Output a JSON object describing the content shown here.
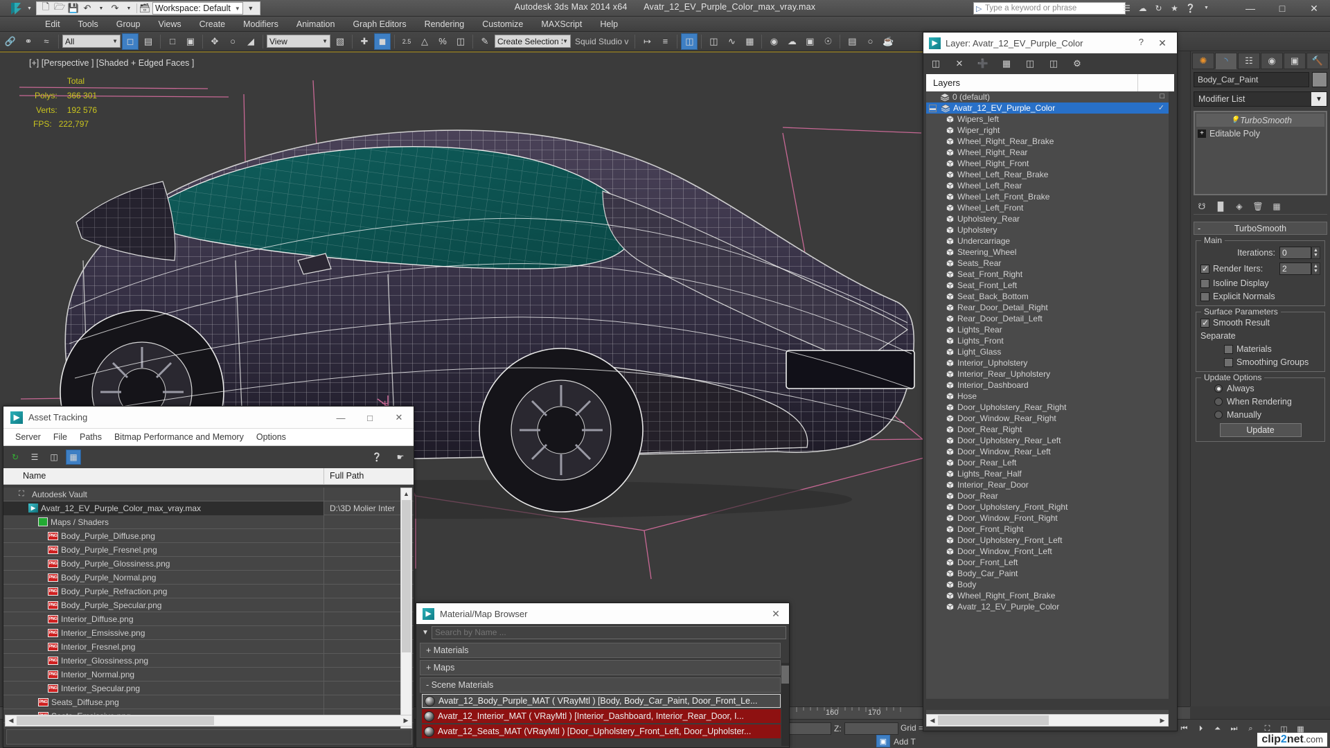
{
  "titlebar": {
    "app_title": "Autodesk 3ds Max  2014 x64",
    "file_title": "Avatr_12_EV_Purple_Color_max_vray.max",
    "workspace": "Workspace: Default",
    "search_placeholder": "Type a keyword or phrase",
    "quick_access": [
      "new-icon",
      "open-icon",
      "save-icon",
      "undo-icon",
      "redo-icon",
      "set-project-icon"
    ],
    "window_buttons": {
      "minimize": "—",
      "maximize": "□",
      "close": "✕"
    }
  },
  "menubar": {
    "items": [
      "Edit",
      "Tools",
      "Group",
      "Views",
      "Create",
      "Modifiers",
      "Animation",
      "Graph Editors",
      "Rendering",
      "Customize",
      "MAXScript",
      "Help"
    ]
  },
  "toolbar": {
    "selection_filter": "All",
    "ref_coord_system": "View",
    "named_selection_set": "Create Selection Se",
    "squid_label": "Squid Studio v",
    "percent_label": "%",
    "snap_label": "2.5"
  },
  "viewport": {
    "label": "[+] [Perspective ] [Shaded + Edged Faces ]",
    "stats_header": "Total",
    "polys_label": "Polys:",
    "polys_value": "366 301",
    "verts_label": "Verts:",
    "verts_value": "192 576",
    "fps_label": "FPS:",
    "fps_value": "222,797"
  },
  "asset_tracking": {
    "title": "Asset Tracking",
    "menu": [
      "Server",
      "File",
      "Paths",
      "Bitmap Performance and Memory",
      "Options"
    ],
    "columns": [
      "Name",
      "Full Path"
    ],
    "window_buttons": {
      "minimize": "—",
      "maximize": "□",
      "close": "✕"
    },
    "rows": [
      {
        "name": "Autodesk Vault",
        "path": "",
        "indent": 1,
        "icon": "vault-icon"
      },
      {
        "name": "Avatr_12_EV_Purple_Color_max_vray.max",
        "path": "D:\\3D Molier Inter",
        "indent": 2,
        "icon": "max-file-icon",
        "selected": true
      },
      {
        "name": "Maps / Shaders",
        "path": "",
        "indent": 3,
        "icon": "shader-icon"
      },
      {
        "name": "Body_Purple_Diffuse.png",
        "path": "",
        "indent": 4,
        "icon": "png-icon"
      },
      {
        "name": "Body_Purple_Fresnel.png",
        "path": "",
        "indent": 4,
        "icon": "png-icon"
      },
      {
        "name": "Body_Purple_Glossiness.png",
        "path": "",
        "indent": 4,
        "icon": "png-icon"
      },
      {
        "name": "Body_Purple_Normal.png",
        "path": "",
        "indent": 4,
        "icon": "png-icon"
      },
      {
        "name": "Body_Purple_Refraction.png",
        "path": "",
        "indent": 4,
        "icon": "png-icon"
      },
      {
        "name": "Body_Purple_Specular.png",
        "path": "",
        "indent": 4,
        "icon": "png-icon"
      },
      {
        "name": "Interior_Diffuse.png",
        "path": "",
        "indent": 4,
        "icon": "png-icon"
      },
      {
        "name": "Interior_Emsissive.png",
        "path": "",
        "indent": 4,
        "icon": "png-icon"
      },
      {
        "name": "Interior_Fresnel.png",
        "path": "",
        "indent": 4,
        "icon": "png-icon"
      },
      {
        "name": "Interior_Glossiness.png",
        "path": "",
        "indent": 4,
        "icon": "png-icon"
      },
      {
        "name": "Interior_Normal.png",
        "path": "",
        "indent": 4,
        "icon": "png-icon"
      },
      {
        "name": "Interior_Specular.png",
        "path": "",
        "indent": 4,
        "icon": "png-icon"
      },
      {
        "name": "Seats_Diffuse.png",
        "path": "",
        "indent": 3,
        "icon": "png-icon"
      },
      {
        "name": "Seats_Emsissive.png",
        "path": "",
        "indent": 3,
        "icon": "png-icon"
      }
    ]
  },
  "material_browser": {
    "title": "Material/Map Browser",
    "search_placeholder": "Search by Name ...",
    "groups": [
      {
        "label": "+ Materials",
        "expanded": false
      },
      {
        "label": "+ Maps",
        "expanded": false
      },
      {
        "label": "- Scene Materials",
        "expanded": true
      }
    ],
    "scene_materials": [
      {
        "label": "Avatr_12_Body_Purple_MAT ( VRayMtl ) [Body, Body_Car_Paint, Door_Front_Le...",
        "selected": true
      },
      {
        "label": "Avatr_12_Interior_MAT ( VRayMtl ) [Interior_Dashboard, Interior_Rear_Door, I...",
        "selected": false
      },
      {
        "label": "Avatr_12_Seats_MAT (VRayMtl ) [Door_Upholstery_Front_Left, Door_Upholster...",
        "selected": false
      }
    ]
  },
  "layer_explorer": {
    "title": "Layer: Avatr_12_EV_Purple_Color",
    "help_glyph": "?",
    "close_glyph": "✕",
    "toolbar_icons": [
      "new-layer-icon",
      "delete-layer-icon",
      "add-layer-icon",
      "select-objects-icon",
      "select-highlighted-icon",
      "highlight-selected-icon",
      "layer-properties-icon"
    ],
    "column_header": "Layers",
    "rows": [
      {
        "name": "0 (default)",
        "type": "layer",
        "selected": false,
        "right": "□"
      },
      {
        "name": "Avatr_12_EV_Purple_Color",
        "type": "layer",
        "selected": true,
        "expandable": true,
        "right": "✓"
      },
      {
        "name": "Wipers_left",
        "type": "object"
      },
      {
        "name": "Wiper_right",
        "type": "object"
      },
      {
        "name": "Wheel_Right_Rear_Brake",
        "type": "object"
      },
      {
        "name": "Wheel_Right_Rear",
        "type": "object"
      },
      {
        "name": "Wheel_Right_Front",
        "type": "object"
      },
      {
        "name": "Wheel_Left_Rear_Brake",
        "type": "object"
      },
      {
        "name": "Wheel_Left_Rear",
        "type": "object"
      },
      {
        "name": "Wheel_Left_Front_Brake",
        "type": "object"
      },
      {
        "name": "Wheel_Left_Front",
        "type": "object"
      },
      {
        "name": "Upholstery_Rear",
        "type": "object"
      },
      {
        "name": "Upholstery",
        "type": "object"
      },
      {
        "name": "Undercarriage",
        "type": "object"
      },
      {
        "name": "Steering_Wheel",
        "type": "object"
      },
      {
        "name": "Seats_Rear",
        "type": "object"
      },
      {
        "name": "Seat_Front_Right",
        "type": "object"
      },
      {
        "name": "Seat_Front_Left",
        "type": "object"
      },
      {
        "name": "Seat_Back_Bottom",
        "type": "object"
      },
      {
        "name": "Rear_Door_Detail_Right",
        "type": "object"
      },
      {
        "name": "Rear_Door_Detail_Left",
        "type": "object"
      },
      {
        "name": "Lights_Rear",
        "type": "object"
      },
      {
        "name": "Lights_Front",
        "type": "object"
      },
      {
        "name": "Light_Glass",
        "type": "object"
      },
      {
        "name": "Interior_Upholstery",
        "type": "object"
      },
      {
        "name": "Interior_Rear_Upholstery",
        "type": "object"
      },
      {
        "name": "Interior_Dashboard",
        "type": "object"
      },
      {
        "name": "Hose",
        "type": "object"
      },
      {
        "name": "Door_Upholstery_Rear_Right",
        "type": "object"
      },
      {
        "name": "Door_Window_Rear_Right",
        "type": "object"
      },
      {
        "name": "Door_Rear_Right",
        "type": "object"
      },
      {
        "name": "Door_Upholstery_Rear_Left",
        "type": "object"
      },
      {
        "name": "Door_Window_Rear_Left",
        "type": "object"
      },
      {
        "name": "Door_Rear_Left",
        "type": "object"
      },
      {
        "name": "Lights_Rear_Half",
        "type": "object"
      },
      {
        "name": "Interior_Rear_Door",
        "type": "object"
      },
      {
        "name": "Door_Rear",
        "type": "object"
      },
      {
        "name": "Door_Upholstery_Front_Right",
        "type": "object"
      },
      {
        "name": "Door_Window_Front_Right",
        "type": "object"
      },
      {
        "name": "Door_Front_Right",
        "type": "object"
      },
      {
        "name": "Door_Upholstery_Front_Left",
        "type": "object"
      },
      {
        "name": "Door_Window_Front_Left",
        "type": "object"
      },
      {
        "name": "Door_Front_Left",
        "type": "object"
      },
      {
        "name": "Body_Car_Paint",
        "type": "object"
      },
      {
        "name": "Body",
        "type": "object"
      },
      {
        "name": "Wheel_Right_Front_Brake",
        "type": "object"
      },
      {
        "name": "Avatr_12_EV_Purple_Color",
        "type": "object"
      }
    ]
  },
  "command_panel": {
    "tabs": [
      "create-tab",
      "modify-tab",
      "hierarchy-tab",
      "motion-tab",
      "display-tab",
      "utilities-tab"
    ],
    "active_tab_index": 1,
    "object_name": "Body_Car_Paint",
    "modifier_list_label": "Modifier List",
    "stack": [
      {
        "label": "TurboSmooth",
        "active": true
      },
      {
        "label": "Editable Poly",
        "active": false
      }
    ],
    "rollout": {
      "title": "TurboSmooth",
      "collapse_glyph": "-",
      "main": {
        "caption": "Main",
        "iterations_label": "Iterations:",
        "iterations_value": "0",
        "render_iters_label": "Render Iters:",
        "render_iters_value": "2",
        "render_iters_checked": true,
        "isoline_label": "Isoline Display",
        "isoline_checked": false,
        "explicit_label": "Explicit Normals",
        "explicit_checked": false
      },
      "surface": {
        "caption": "Surface Parameters",
        "smooth_result_label": "Smooth Result",
        "smooth_result_checked": true,
        "separate_label": "Separate",
        "materials_label": "Materials",
        "materials_checked": false,
        "smoothing_groups_label": "Smoothing Groups",
        "smoothing_groups_checked": false
      },
      "update": {
        "caption": "Update Options",
        "options": [
          "Always",
          "When Rendering",
          "Manually"
        ],
        "selected_index": 0,
        "button_label": "Update"
      }
    }
  },
  "statusbar": {
    "z_label": "Z:",
    "grid_label": "Grid =",
    "add_time_tag_label": "Add T",
    "time_ticks": [
      "160",
      "170"
    ],
    "watermark": {
      "c": "clip",
      "two": "2",
      "net": "net",
      "com": ".com"
    }
  }
}
